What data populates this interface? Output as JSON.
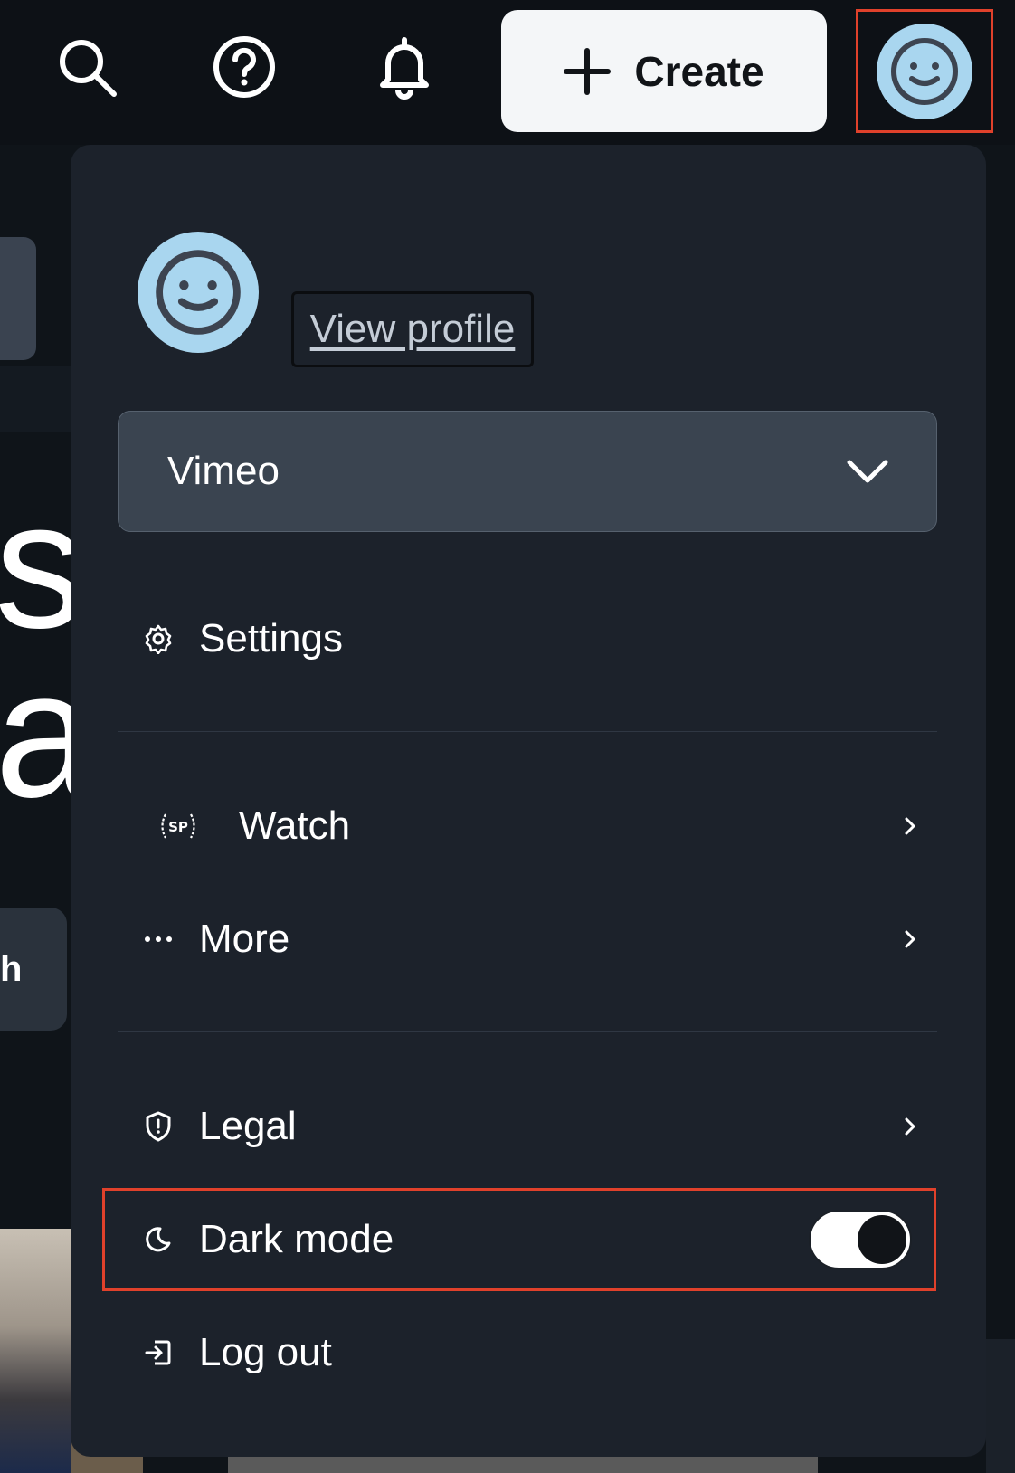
{
  "topbar": {
    "search_icon": "search-icon",
    "help_icon": "help-circle-icon",
    "bell_icon": "bell-icon",
    "create_label": "Create",
    "avatar_icon": "smiley-avatar-icon"
  },
  "background": {
    "big_text_1": "s",
    "big_text_2": "a",
    "button_fragment": "h"
  },
  "menu": {
    "view_profile": "View profile",
    "account_selected": "Vimeo",
    "items": [
      {
        "label": "Settings",
        "icon": "gear-icon"
      },
      {
        "label": "Watch",
        "icon": "staff-picks-icon",
        "icon_text": "SP"
      },
      {
        "label": "More",
        "icon": "ellipsis-icon"
      },
      {
        "label": "Legal",
        "icon": "shield-icon"
      },
      {
        "label": "Dark mode",
        "icon": "moon-icon",
        "toggle_on": true
      },
      {
        "label": "Log out",
        "icon": "logout-icon"
      }
    ]
  },
  "colors": {
    "background": "#0f1419",
    "panel": "#1c222b",
    "select": "#3a4450",
    "avatar": "#a9d6ef",
    "highlight": "#e0412b",
    "create_button": "#f4f6f8"
  }
}
